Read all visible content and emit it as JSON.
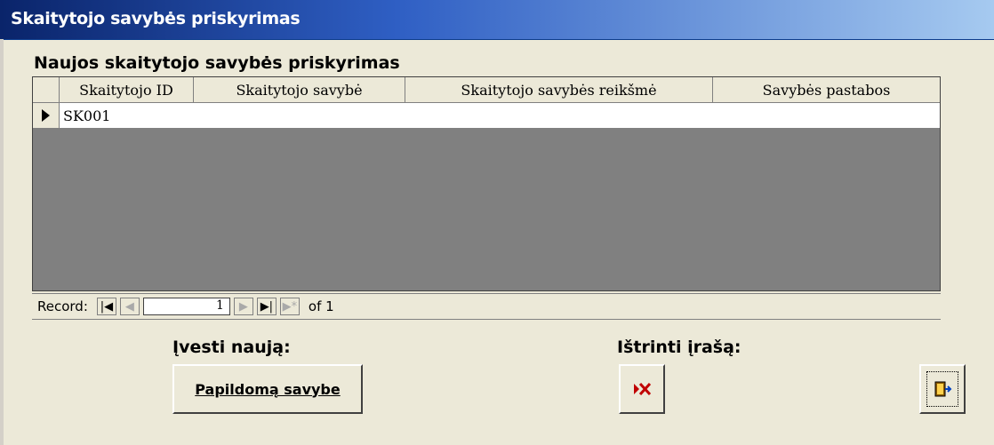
{
  "window": {
    "title": "Skaitytojo savybės priskyrimas"
  },
  "subform": {
    "label": "Naujos skaitytojo savybės priskyrimas",
    "columns": [
      "Skaitytojo ID",
      "Skaitytojo savybė",
      "Skaitytojo savybės reikšmė",
      "Savybės pastabos"
    ],
    "rows": [
      [
        "SK001",
        "",
        "",
        ""
      ]
    ]
  },
  "navigation": {
    "record_label": "Record:",
    "current_record": "1",
    "of_label": "of 1"
  },
  "actions": {
    "add_caption": "Įvesti naują:",
    "add_button_label": "Papildomą savybe",
    "delete_caption": "Ištrinti įrašą:"
  },
  "icons": {
    "delete": "delete-record-icon",
    "close": "close-form-icon"
  }
}
